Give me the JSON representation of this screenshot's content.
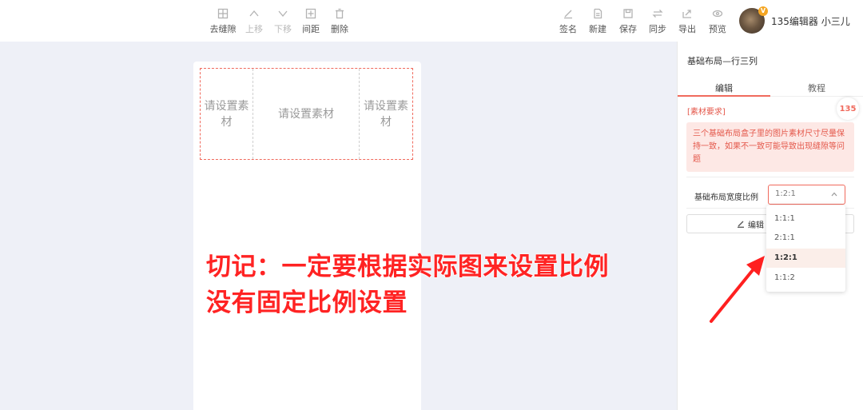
{
  "toolbar": {
    "left": [
      {
        "label": "去缝隙",
        "icon": "grid-icon",
        "enabled": true
      },
      {
        "label": "上移",
        "icon": "chevron-up-icon",
        "enabled": false
      },
      {
        "label": "下移",
        "icon": "chevron-down-icon",
        "enabled": false
      },
      {
        "label": "间距",
        "icon": "spacing-icon",
        "enabled": true
      },
      {
        "label": "删除",
        "icon": "trash-icon",
        "enabled": true
      }
    ],
    "right": [
      {
        "label": "签名",
        "icon": "pen-icon"
      },
      {
        "label": "新建",
        "icon": "new-file-icon"
      },
      {
        "label": "保存",
        "icon": "save-icon"
      },
      {
        "label": "同步",
        "icon": "sync-icon"
      },
      {
        "label": "导出",
        "icon": "export-icon"
      },
      {
        "label": "预览",
        "icon": "eye-icon"
      }
    ],
    "user": {
      "name": "135编辑器 小三儿",
      "badge": "V"
    }
  },
  "canvas": {
    "cells": [
      "请设置素材",
      "请设置素材",
      "请设置素材"
    ],
    "callout_line1": "切记：一定要根据实际图来设置比例",
    "callout_line2": "没有固定比例设置"
  },
  "panel": {
    "title": "基础布局—行三列",
    "tabs": [
      "编辑",
      "教程"
    ],
    "active_tab": "编辑",
    "logo_text": "135",
    "requirement_label": "[素材要求]",
    "requirement_text": "三个基础布局盒子里的图片素材尺寸尽量保持一致，如果不一致可能导致出现缝隙等问题",
    "ratio_label": "基础布局宽度比例",
    "ratio_value": "1:2:1",
    "edit_button": "编辑",
    "ratio_options": [
      "1:1:1",
      "2:1:1",
      "1:2:1",
      "1:1:2"
    ],
    "selected_option": "1:2:1"
  },
  "colors": {
    "accent": "#f06a5d",
    "callout": "#ff2323",
    "workspace_bg": "#eef0f7",
    "requirement_bg": "#fde8e5"
  }
}
